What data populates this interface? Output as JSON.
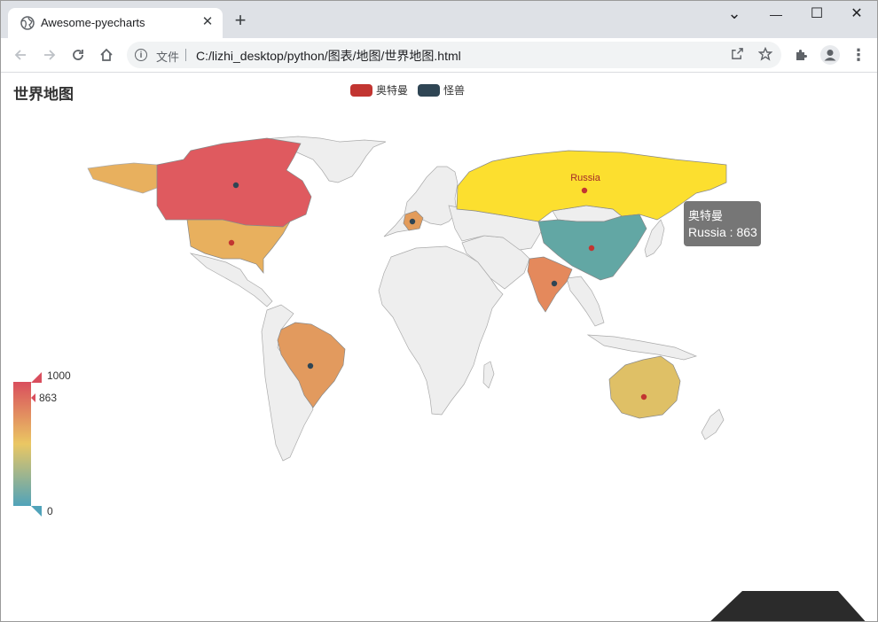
{
  "browser": {
    "tab_title": "Awesome-pyecharts",
    "tab_close": "✕",
    "new_tab": "+",
    "file_label": "文件",
    "url": "C:/lizhi_desktop/python/图表/地图/世界地图.html",
    "window_controls": {
      "dropdown": "⌄",
      "minimize": "—",
      "maximize": "☐",
      "close": "✕"
    }
  },
  "page": {
    "title": "世界地图"
  },
  "legend": [
    {
      "name": "奥特曼",
      "color": "#c23531"
    },
    {
      "name": "怪兽",
      "color": "#2f4554"
    }
  ],
  "visual_map": {
    "max_label": "1000",
    "min_label": "0",
    "pointer_label": "863",
    "colors": [
      "#50a3ba",
      "#eac763",
      "#d94e5d"
    ]
  },
  "map": {
    "label": "Russia",
    "regions": [
      {
        "name": "Russia",
        "series": "奥特曼",
        "value": 863,
        "color": "#fcdf2f"
      },
      {
        "name": "China",
        "color": "#62a7a4"
      },
      {
        "name": "Canada",
        "color": "#df5a5f"
      },
      {
        "name": "United States",
        "color": "#e8b05e"
      },
      {
        "name": "Brazil",
        "color": "#e29a5e"
      },
      {
        "name": "India",
        "color": "#e4895c"
      },
      {
        "name": "Australia",
        "color": "#dfc066"
      },
      {
        "name": "France",
        "color": "#e39c5b"
      }
    ]
  },
  "tooltip": {
    "series": "奥特曼",
    "line": "Russia : 863"
  },
  "icons": [
    "globe-icon",
    "back-icon",
    "forward-icon",
    "reload-icon",
    "home-icon",
    "info-icon",
    "share-icon",
    "star-icon",
    "extensions-icon",
    "profile-icon",
    "menu-icon"
  ]
}
